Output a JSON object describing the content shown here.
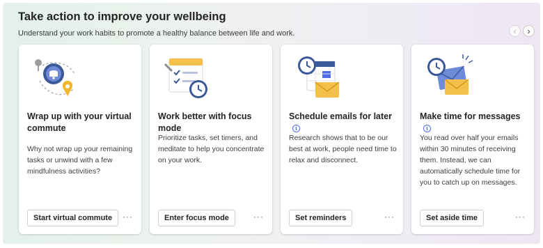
{
  "header": {
    "title": "Take action to improve your wellbeing",
    "subtitle": "Understand your work habits to promote a healthy balance between life and work.",
    "prev_icon": "‹",
    "next_icon": "›"
  },
  "cards": [
    {
      "title": "Wrap up with your virtual commute",
      "description": "Why not wrap up your remaining tasks or unwind with a few mindfulness activities?",
      "action": "Start virtual commute",
      "more": "···",
      "illustration": "map-pin-bell-icon"
    },
    {
      "title": "Work better with focus mode",
      "description": "Prioritize tasks, set timers, and meditate to help you concentrate on your work.",
      "action": "Enter focus mode",
      "more": "···",
      "illustration": "checklist-clock-icon"
    },
    {
      "title": "Schedule emails for later",
      "info": "i",
      "description": "Research shows that to be our best at work, people need time to relax and disconnect.",
      "action": "Set reminders",
      "more": "···",
      "illustration": "calendar-clock-envelope-icon"
    },
    {
      "title": "Make time for messages",
      "info": "i",
      "description": "You read over half your emails within 30 minutes of receiving them. Instead, we can automatically schedule time for you to catch up on messages.",
      "action": "Set aside time",
      "more": "···",
      "illustration": "clock-envelope-icon"
    }
  ],
  "colors": {
    "accent": "#4f6bed",
    "envelope_yellow": "#f3c14b",
    "clock_blue": "#3b5998"
  }
}
